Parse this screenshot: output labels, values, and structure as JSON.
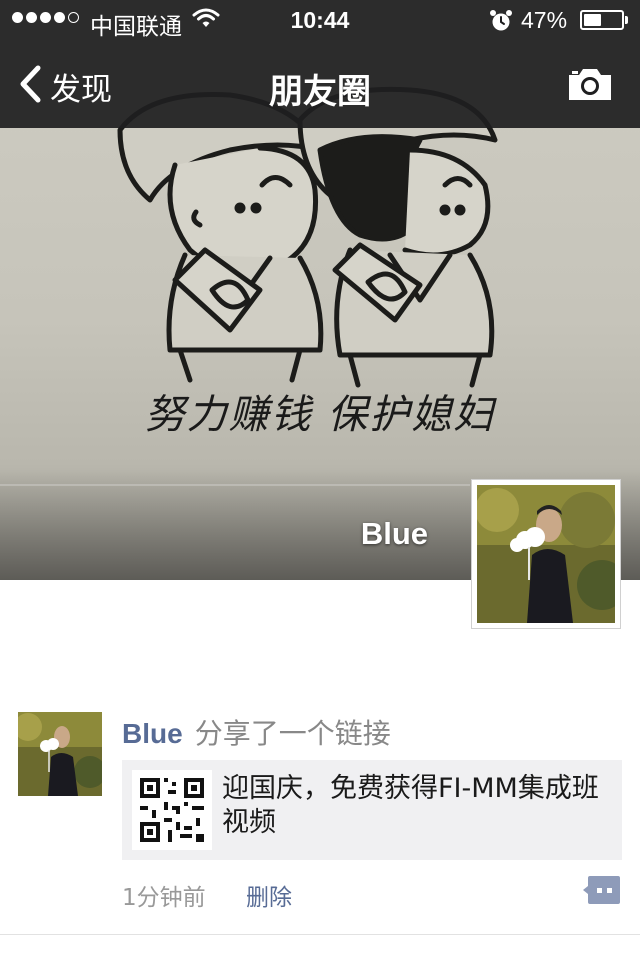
{
  "status_bar": {
    "carrier": "中国联通",
    "time": "10:44",
    "battery_text": "47%",
    "battery_level": 0.47,
    "signal_dots_filled": 4,
    "signal_dots_total": 5
  },
  "nav": {
    "back_label": "发现",
    "title": "朋友圈"
  },
  "cover": {
    "caption": "努力赚钱 保护媳妇",
    "user_name": "Blue"
  },
  "post": {
    "user_name": "Blue",
    "action_text": "分享了一个链接",
    "link_title": "迎国庆，免费获得FI-MM集成班视频",
    "time": "1分钟前",
    "delete_label": "删除"
  },
  "colors": {
    "bar_background": "#1e1e20",
    "link_blue": "#576b95",
    "comment_button": "#8e9bb9"
  },
  "icons": {
    "back": "chevron-left-icon",
    "camera": "camera-icon",
    "wifi": "wifi-icon",
    "alarm": "alarm-icon",
    "comment": "comment-icon"
  }
}
